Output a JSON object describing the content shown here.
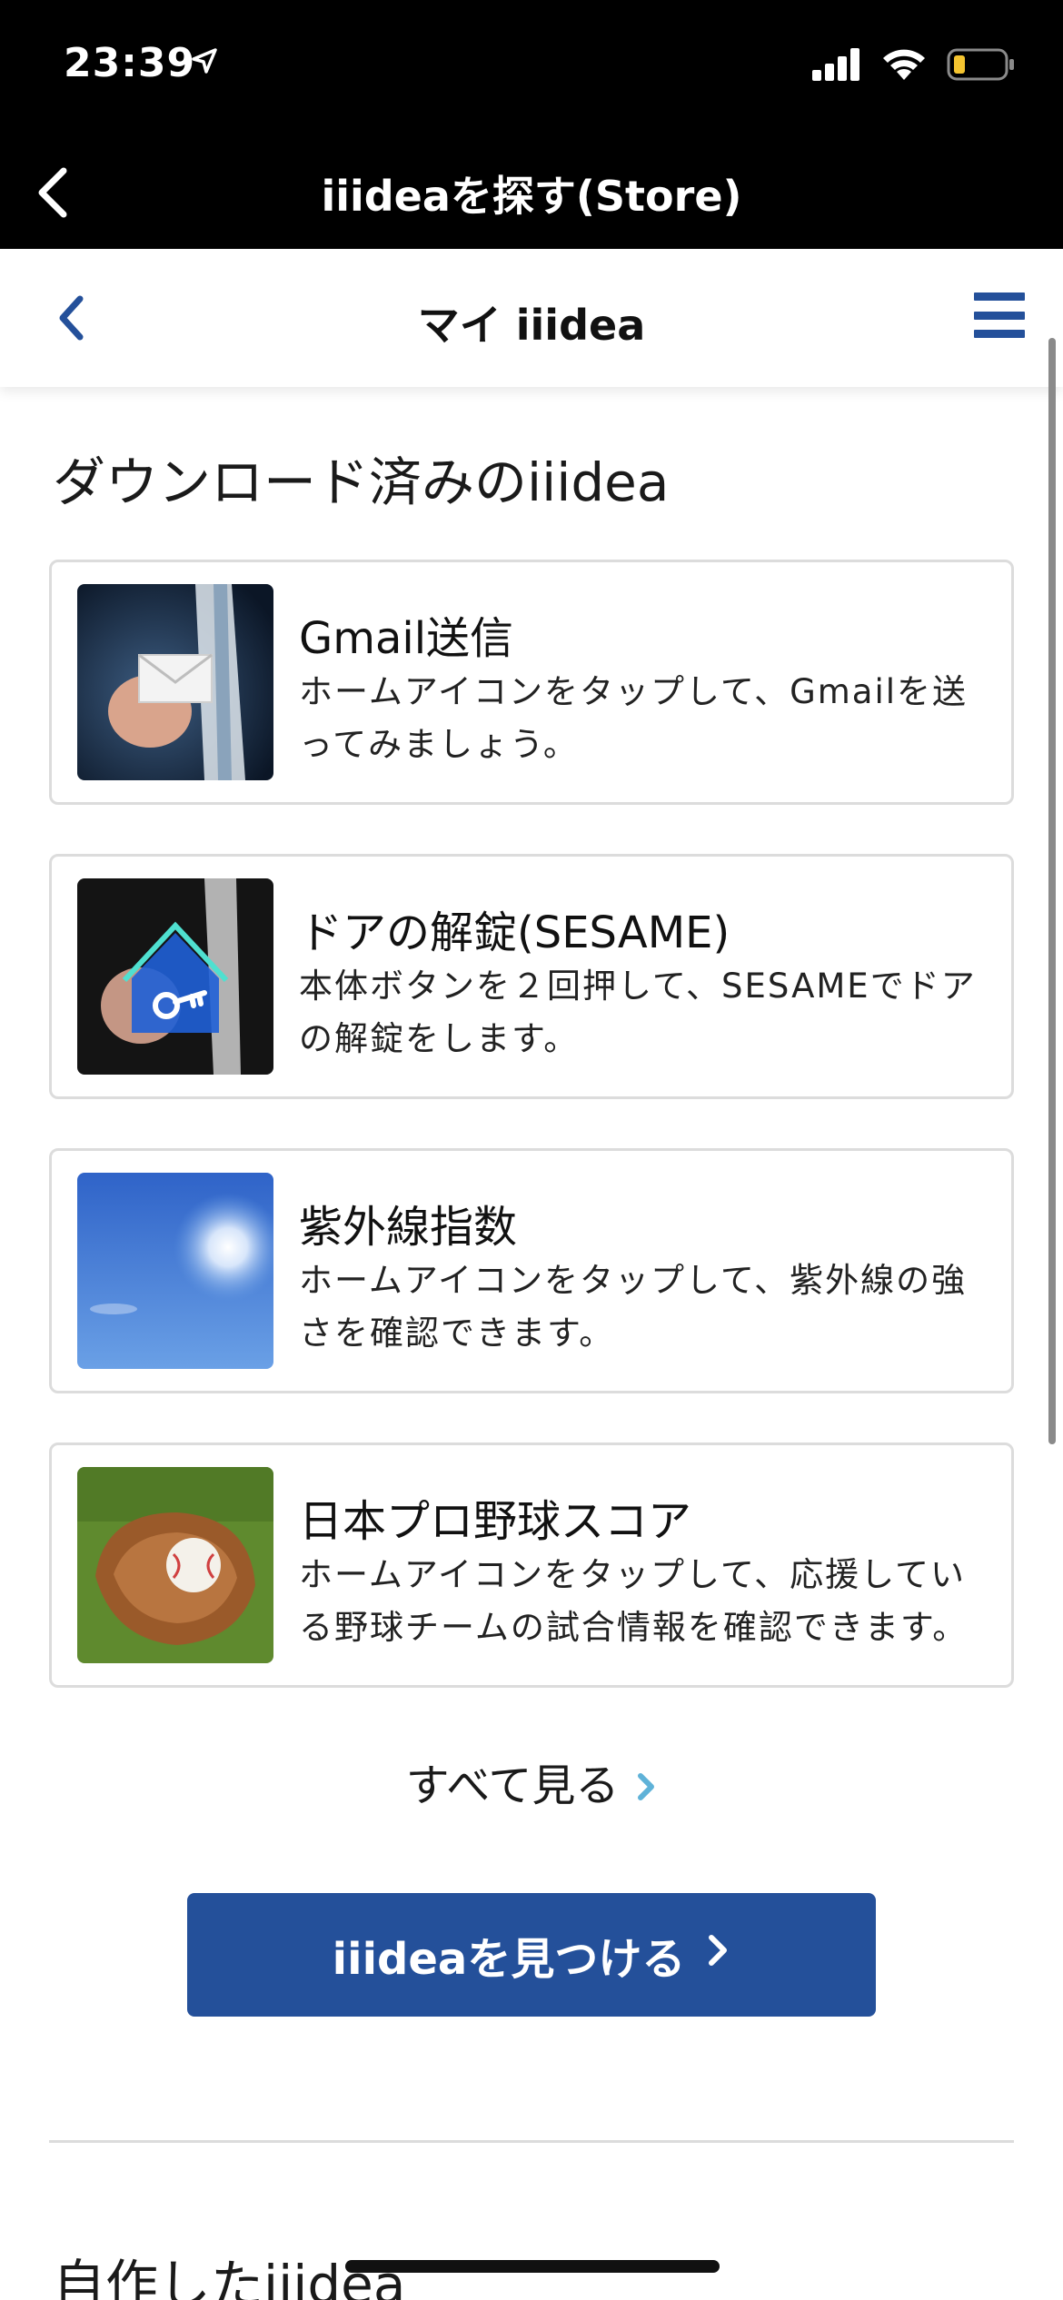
{
  "status_bar": {
    "time": "23:39",
    "location_icon": "location-arrow-icon",
    "signal_icon": "cellular-signal-icon",
    "wifi_icon": "wifi-icon",
    "battery_icon": "battery-low-icon"
  },
  "nav_bar": {
    "title": "iiideaを探す(Store)",
    "back_icon": "chevron-left-icon"
  },
  "web_header": {
    "title": "マイ iiidea",
    "back_icon": "chevron-left-icon",
    "menu_icon": "hamburger-menu-icon",
    "accent_color": "#24509a"
  },
  "downloaded_section": {
    "title": "ダウンロード済みのiiidea",
    "items": [
      {
        "title": "Gmail送信",
        "description": "ホームアイコンをタップして、Gmailを送ってみましょう。",
        "thumbnail": "finger-press-envelope-image"
      },
      {
        "title": "ドアの解錠(SESAME)",
        "description": "本体ボタンを２回押して、SESAMEでドアの解錠をします。",
        "thumbnail": "finger-press-house-key-image"
      },
      {
        "title": "紫外線指数",
        "description": "ホームアイコンをタップして、紫外線の強さを確認できます。",
        "thumbnail": "blue-sky-sun-image"
      },
      {
        "title": "日本プロ野球スコア",
        "description": "ホームアイコンをタップして、応援している野球チームの試合情報を確認できます。",
        "thumbnail": "baseball-glove-image"
      }
    ],
    "see_all_label": "すべて見る",
    "see_all_icon": "chevron-right-icon"
  },
  "find_button": {
    "label": "iiideaを見つける",
    "icon": "chevron-right-icon"
  },
  "created_section": {
    "title": "自作したiiidea"
  }
}
